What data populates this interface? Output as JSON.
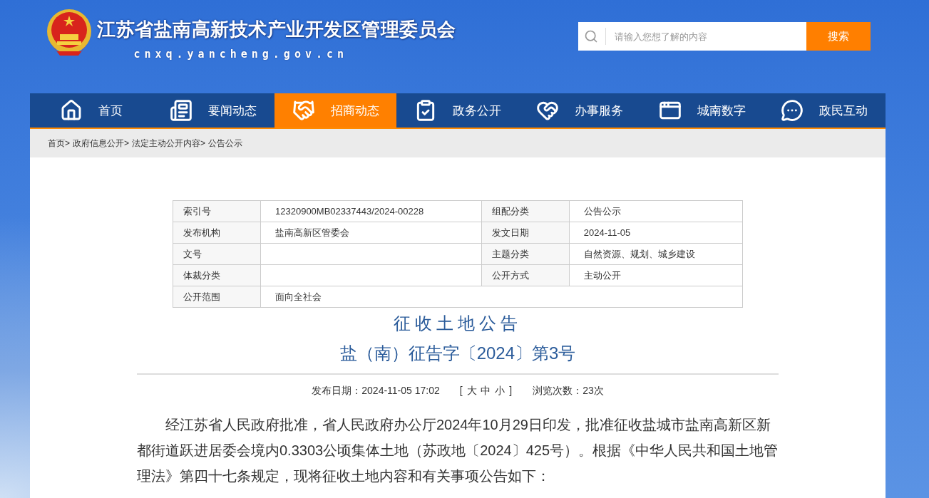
{
  "header": {
    "site_title": "江苏省盐南高新技术产业开发区管理委员会",
    "domain": "cnxq.yancheng.gov.cn"
  },
  "search": {
    "placeholder": "请输入您想了解的内容",
    "button": "搜索"
  },
  "nav": [
    {
      "label": "首页",
      "selected": false
    },
    {
      "label": "要闻动态",
      "selected": false
    },
    {
      "label": "招商动态",
      "selected": true
    },
    {
      "label": "政务公开",
      "selected": false
    },
    {
      "label": "办事服务",
      "selected": false
    },
    {
      "label": "城南数字",
      "selected": false
    },
    {
      "label": "政民互动",
      "selected": false
    }
  ],
  "breadcrumb": [
    "首页>",
    "政府信息公开>",
    "法定主动公开内容>",
    "公告公示"
  ],
  "info_table": [
    [
      {
        "label": "索引号",
        "value": "12320900MB02337443/2024-00228"
      },
      {
        "label": "组配分类",
        "value": "公告公示"
      }
    ],
    [
      {
        "label": "发布机构",
        "value": "盐南高新区管委会"
      },
      {
        "label": "发文日期",
        "value": "2024-11-05"
      }
    ],
    [
      {
        "label": "文号"
      },
      {
        "label": "主题分类",
        "value": "自然资源、规划、城乡建设"
      }
    ],
    [
      {
        "label": "体裁分类"
      },
      {
        "label": "公开方式",
        "value": "主动公开"
      }
    ],
    [
      {
        "label": "公开范围",
        "value": "面向全社会"
      }
    ]
  ],
  "article": {
    "title": "征收土地公告",
    "subtitle": "盐（南）征告字〔2024〕第3号",
    "meta": {
      "date": "发布日期：2024-11-05 17:02",
      "font_size": "[ 大 中 小 ]",
      "views": "浏览次数：23次"
    },
    "paragraph": "经江苏省人民政府批准，省人民政府办公厅2024年10月29日印发，批准征收盐城市盐南高新区新都街道跃进居委会境内0.3303公顷集体土地（苏政地〔2024〕425号）。根据《中华人民共和国土地管理法》第四十七条规定，现将征收土地内容和有关事项公告如下："
  }
}
